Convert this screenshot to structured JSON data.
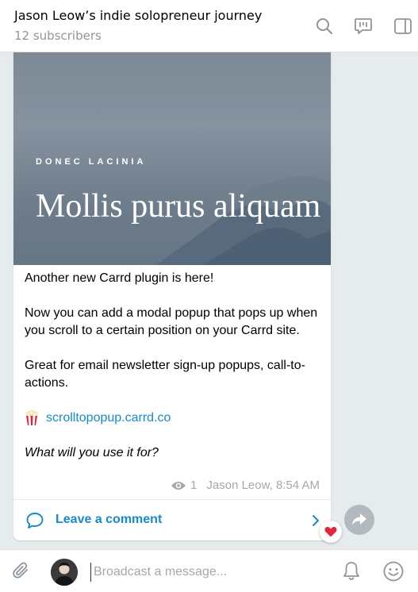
{
  "header": {
    "title": "Jason Leow’s indie solopreneur journey",
    "subtitle": "12 subscribers",
    "icons": [
      "search-icon",
      "discussion-icon",
      "sidebar-toggle-icon"
    ]
  },
  "post": {
    "hero": {
      "kicker": "DONEC LACINIA",
      "headline": "Mollis purus aliquam"
    },
    "paragraphs": [
      "Another new Carrd plugin is here!",
      "Now you can add a modal popup that pops up when you scroll to a certain position on your Carrd site.",
      "Great for email newsletter sign-up popups, call-to-actions."
    ],
    "link": {
      "emoji": "popcorn-icon",
      "text": "scrolltopopup.carrd.co"
    },
    "question": "What will you use it for?",
    "views": "1",
    "author_time": "Jason Leow, 8:54 AM",
    "comment_label": "Leave a comment",
    "reaction": "heart-icon"
  },
  "composer": {
    "placeholder": "Broadcast a message..."
  },
  "colors": {
    "accent": "#168acd",
    "muted": "#8e959b",
    "background": "#e6ebee"
  }
}
